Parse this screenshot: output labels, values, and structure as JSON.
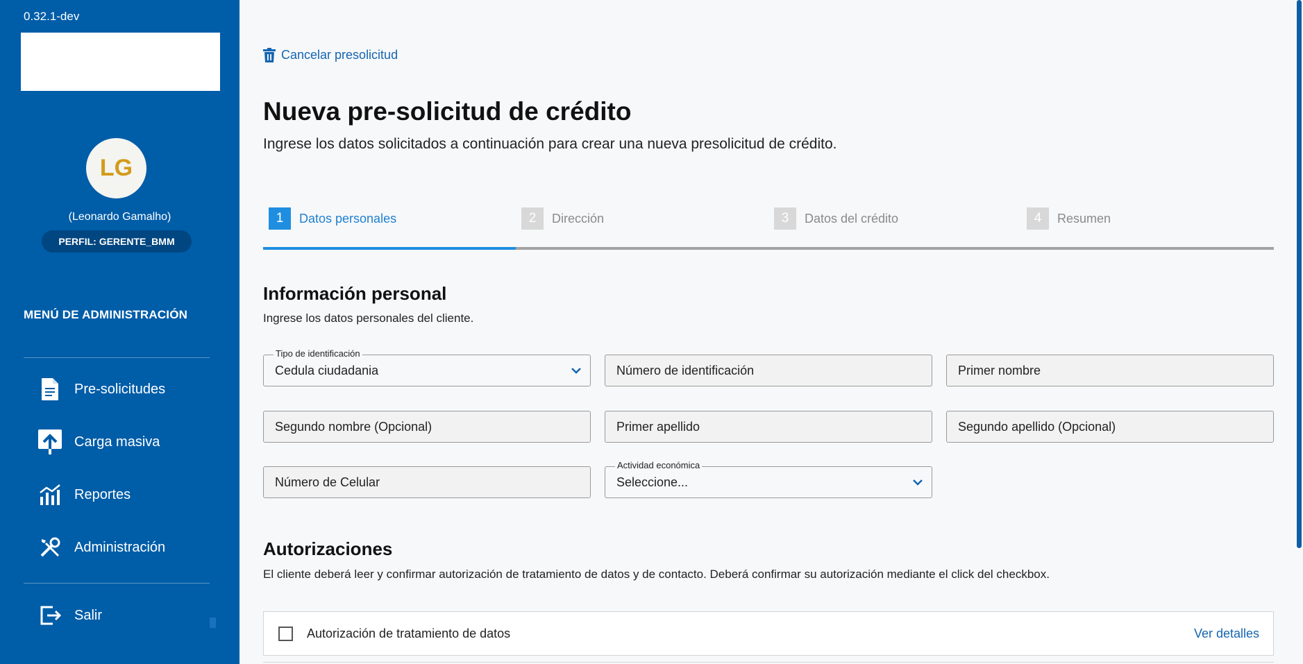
{
  "sidebar": {
    "version": "0.32.1-dev",
    "user": {
      "initials": "LG",
      "name": "(Leonardo Gamalho)",
      "profile": "PERFIL: GERENTE_BMM"
    },
    "menu_title": "MENÚ DE ADMINISTRACIÓN",
    "items": [
      {
        "label": "Pre-solicitudes",
        "icon": "document-icon"
      },
      {
        "label": "Carga masiva",
        "icon": "upload-icon"
      },
      {
        "label": "Reportes",
        "icon": "chart-icon"
      },
      {
        "label": "Administración",
        "icon": "tools-icon"
      },
      {
        "label": "Salir",
        "icon": "logout-icon"
      }
    ]
  },
  "header": {
    "cancel_label": "Cancelar presolicitud",
    "title": "Nueva pre-solicitud de crédito",
    "subtitle": "Ingrese los datos solicitados a continuación para crear una nueva presolicitud de crédito."
  },
  "stepper": {
    "steps": [
      {
        "number": "1",
        "label": "Datos personales",
        "active": true
      },
      {
        "number": "2",
        "label": "Dirección",
        "active": false
      },
      {
        "number": "3",
        "label": "Datos del crédito",
        "active": false
      },
      {
        "number": "4",
        "label": "Resumen",
        "active": false
      }
    ],
    "progress": 0.25
  },
  "personal_info": {
    "title": "Información personal",
    "description": "Ingrese los datos personales del cliente.",
    "id_type": {
      "label": "Tipo de identificación",
      "value": "Cedula ciudadania"
    },
    "id_number": {
      "placeholder": "Número de identificación"
    },
    "first_name": {
      "placeholder": "Primer nombre"
    },
    "second_name": {
      "placeholder": "Segundo nombre (Opcional)"
    },
    "first_surname": {
      "placeholder": "Primer apellido"
    },
    "second_surname": {
      "placeholder": "Segundo apellido (Opcional)"
    },
    "phone": {
      "placeholder": "Número de Celular"
    },
    "economic_activity": {
      "label": "Actividad económica",
      "value": "Seleccione..."
    }
  },
  "authorizations": {
    "title": "Autorizaciones",
    "description": "El cliente deberá leer y confirmar autorización de tratamiento de datos y de contacto. Deberá confirmar su autorización mediante el click del checkbox.",
    "items": [
      {
        "label": "Autorización de tratamiento de datos",
        "link": "Ver detalles",
        "checked": false
      }
    ]
  },
  "colors": {
    "sidebar_bg": "#005da8",
    "accent": "#1f8ee0",
    "link": "#1565b0",
    "avatar_text": "#d39b1a"
  }
}
